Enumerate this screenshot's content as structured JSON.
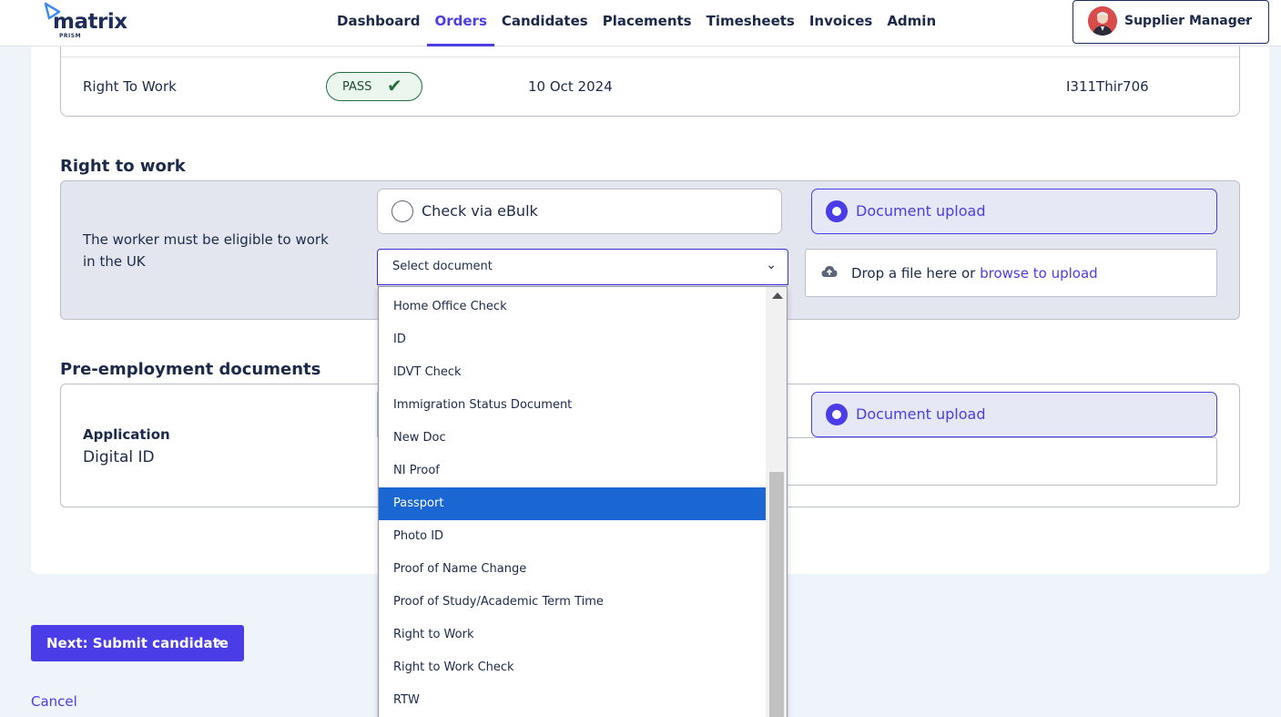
{
  "header": {
    "logo_text": "matrix",
    "logo_sub": "PRISM",
    "nav": [
      "Dashboard",
      "Orders",
      "Candidates",
      "Placements",
      "Timesheets",
      "Invoices",
      "Admin"
    ],
    "active_nav": "Orders",
    "user_name": "Supplier Manager"
  },
  "check_row": {
    "name": "Right To Work",
    "status": "PASS",
    "date": "10 Oct 2024",
    "reference": "I311Thir706"
  },
  "right_to_work": {
    "title": "Right to work",
    "description": "The worker must be eligible to work in the UK",
    "option_ebulk": "Check via eBulk",
    "option_upload": "Document upload",
    "select_value": "Select document",
    "drop_text": "Drop a file here or",
    "drop_link": "browse to upload"
  },
  "pre_employment": {
    "title": "Pre-employment documents",
    "label": "Application",
    "value": "Digital ID",
    "option_upload": "Document upload"
  },
  "dropdown": {
    "items": [
      "Home Office Check",
      "ID",
      "IDVT Check",
      "Immigration Status Document",
      "New Doc",
      "NI Proof",
      "Passport",
      "Photo ID",
      "Proof of Name Change",
      "Proof of Study/Academic Term Time",
      "Right to Work",
      "Right to Work Check",
      "RTW"
    ],
    "highlighted": "Passport"
  },
  "actions": {
    "next_label": "Next: Submit candidate",
    "cancel_label": "Cancel"
  },
  "colors": {
    "accent": "#4a3de8",
    "highlight": "#1a66d2",
    "pass": "#1f6e3c"
  }
}
